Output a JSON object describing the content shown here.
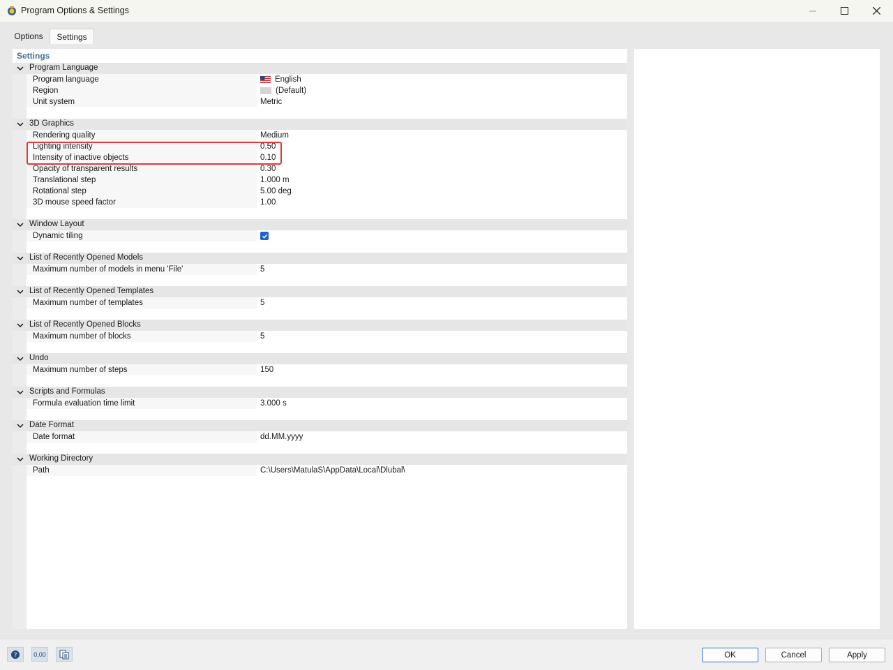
{
  "window": {
    "title": "Program Options & Settings"
  },
  "tabs": [
    {
      "label": "Options",
      "active": false
    },
    {
      "label": "Settings",
      "active": true
    }
  ],
  "panel": {
    "heading": "Settings"
  },
  "groups": {
    "program_language": {
      "title": "Program Language",
      "rows": [
        {
          "label": "Program language",
          "value": "English",
          "icon": "us-flag-icon"
        },
        {
          "label": "Region",
          "value": "(Default)",
          "icon": "region-swatch-icon"
        },
        {
          "label": "Unit system",
          "value": "Metric"
        }
      ]
    },
    "graphics": {
      "title": "3D Graphics",
      "rows": [
        {
          "label": "Rendering quality",
          "value": "Medium"
        },
        {
          "label": "Lighting intensity",
          "value": "0.50"
        },
        {
          "label": "Intensity of inactive objects",
          "value": "0.10"
        },
        {
          "label": "Opacity of transparent results",
          "value": "0.30"
        },
        {
          "label": "Translational step",
          "value": "1.000 m"
        },
        {
          "label": "Rotational step",
          "value": "5.00 deg"
        },
        {
          "label": "3D mouse speed factor",
          "value": "1.00"
        }
      ]
    },
    "window_layout": {
      "title": "Window Layout",
      "rows": [
        {
          "label": "Dynamic tiling",
          "checked": true
        }
      ]
    },
    "recent_models": {
      "title": "List of Recently Opened Models",
      "rows": [
        {
          "label": "Maximum number of models in menu 'File'",
          "value": "5"
        }
      ]
    },
    "recent_templates": {
      "title": "List of Recently Opened Templates",
      "rows": [
        {
          "label": "Maximum number of templates",
          "value": "5"
        }
      ]
    },
    "recent_blocks": {
      "title": "List of Recently Opened Blocks",
      "rows": [
        {
          "label": "Maximum number of blocks",
          "value": "5"
        }
      ]
    },
    "undo": {
      "title": "Undo",
      "rows": [
        {
          "label": "Maximum number of steps",
          "value": "150"
        }
      ]
    },
    "scripts": {
      "title": "Scripts and Formulas",
      "rows": [
        {
          "label": "Formula evaluation time limit",
          "value": "3.000 s"
        }
      ]
    },
    "date_format": {
      "title": "Date Format",
      "rows": [
        {
          "label": "Date format",
          "value": "dd.MM.yyyy"
        }
      ]
    },
    "working_directory": {
      "title": "Working Directory",
      "rows": [
        {
          "label": "Path",
          "value": "C:\\Users\\MatulaS\\AppData\\Local\\Dlubal\\"
        }
      ]
    }
  },
  "toolbar": {
    "units_label": "0,00"
  },
  "buttons": {
    "ok": "OK",
    "cancel": "Cancel",
    "apply": "Apply"
  },
  "colors": {
    "accent": "#1e66c8",
    "highlight": "#e0393e",
    "heading": "#4a6f96"
  }
}
